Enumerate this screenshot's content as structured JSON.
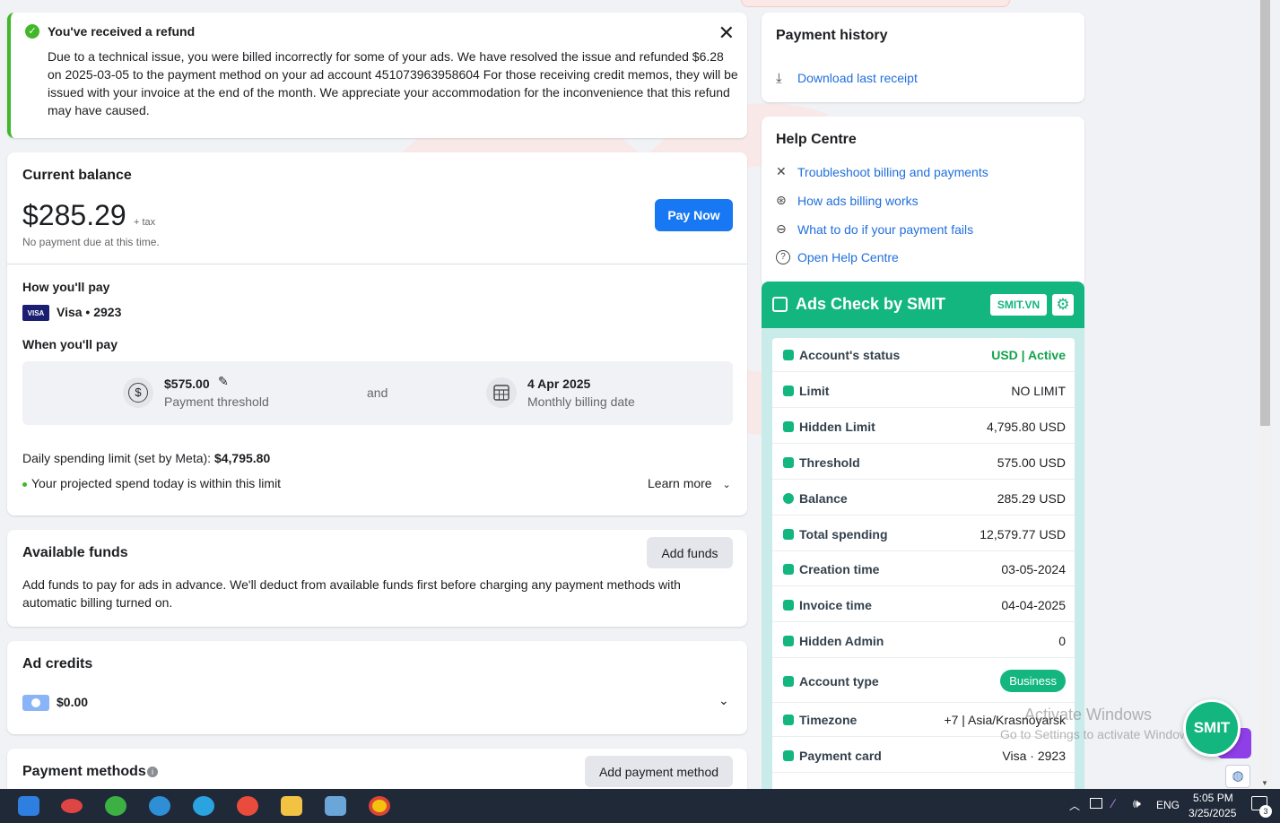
{
  "refund_notice": {
    "title": "You've received a refund",
    "body": "Due to a technical issue, you were billed incorrectly for some of your ads. We have resolved the issue and refunded $6.28 on 2025-03-05 to the payment method on your ad account 451073963958604 For those receiving credit memos, they will be issued with your invoice at the end of the month. We appreciate your accommodation for the inconvenience that this refund may have caused."
  },
  "balance": {
    "title": "Current balance",
    "amount": "$285.29",
    "tax": "+ tax",
    "note": "No payment due at this time.",
    "pay_button": "Pay Now",
    "how_title": "How you'll pay",
    "card_brand": "VISA",
    "card_label": "Visa • 2923",
    "when_title": "When you'll pay",
    "threshold_value": "$575.00",
    "threshold_label": "Payment threshold",
    "and": "and",
    "date_value": "4 Apr 2025",
    "date_label": "Monthly billing date",
    "limit_prefix": "Daily spending limit (set by Meta): ",
    "limit_value": "$4,795.80",
    "projected": "Your projected spend today is within this limit",
    "learn_more": "Learn more"
  },
  "funds": {
    "title": "Available funds",
    "add_button": "Add funds",
    "body": "Add funds to pay for ads in advance. We'll deduct from available funds first before charging any payment methods with automatic billing turned on."
  },
  "credits": {
    "title": "Ad credits",
    "amount": "$0.00"
  },
  "methods": {
    "title": "Payment methods",
    "add_button": "Add payment method"
  },
  "payment_history": {
    "title": "Payment history",
    "download": "Download last receipt"
  },
  "help": {
    "title": "Help Centre",
    "links": [
      {
        "label": "Troubleshoot billing and payments",
        "icon": "tools-icon"
      },
      {
        "label": "How ads billing works",
        "icon": "circles-icon"
      },
      {
        "label": "What to do if your payment fails",
        "icon": "minus-circle-icon"
      },
      {
        "label": "Open Help Centre",
        "icon": "question-icon"
      }
    ]
  },
  "smit": {
    "title": "Ads Check by SMIT",
    "badge": "SMIT.VN",
    "fab": "SMIT",
    "rows": [
      {
        "label": "Account's status",
        "value": "USD | Active"
      },
      {
        "label": "Limit",
        "value": "NO LIMIT"
      },
      {
        "label": "Hidden Limit",
        "value": "4,795.80 USD"
      },
      {
        "label": "Threshold",
        "value": "575.00 USD"
      },
      {
        "label": "Balance",
        "value": "285.29 USD"
      },
      {
        "label": "Total spending",
        "value": "12,579.77 USD"
      },
      {
        "label": "Creation time",
        "value": "03-05-2024"
      },
      {
        "label": "Invoice time",
        "value": "04-04-2025"
      },
      {
        "label": "Hidden Admin",
        "value": "0"
      },
      {
        "label": "Account type",
        "value": "Business"
      },
      {
        "label": "Timezone",
        "value": "+7 | Asia/Krasnoyarsk"
      },
      {
        "label": "Payment card",
        "value": "Visa · 2923"
      }
    ]
  },
  "activate": {
    "line1": "Activate Windows",
    "line2": "Go to Settings to activate Windows."
  },
  "taskbar": {
    "lang": "ENG",
    "time": "5:05 PM",
    "date": "3/25/2025",
    "notif_count": "3"
  },
  "colors": {
    "accent": "#1877f2",
    "smit_green": "#13b67f",
    "success": "#42b72a"
  }
}
